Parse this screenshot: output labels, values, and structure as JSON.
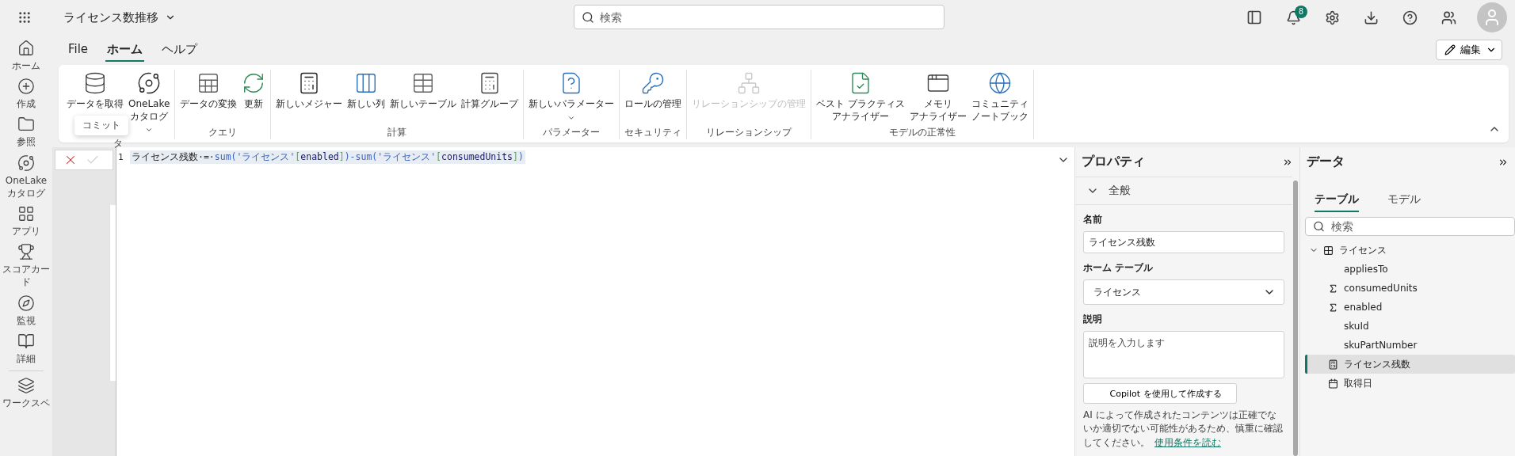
{
  "topbar": {
    "title": "ライセンス数推移",
    "search": {
      "placeholder": "検索"
    },
    "notifications": "8"
  },
  "rail": [
    {
      "label": "ホーム"
    },
    {
      "label": "作成"
    },
    {
      "label": "参照"
    },
    {
      "label": "OneLake カタログ"
    },
    {
      "label": "アプリ"
    },
    {
      "label": "スコアカード"
    },
    {
      "label": "監視"
    },
    {
      "label": "詳細"
    },
    {
      "label": "ワークスペ"
    }
  ],
  "ribbon_tabs": [
    {
      "label": "File",
      "selected": false
    },
    {
      "label": "ホーム",
      "selected": true
    },
    {
      "label": "ヘルプ",
      "selected": false
    }
  ],
  "edit_button": "編集",
  "ribbon_groups": [
    {
      "label": "タ",
      "items": [
        {
          "lines": [
            "データを取得"
          ],
          "disabled": false
        },
        {
          "lines": [
            "OneLake",
            "カタログ"
          ],
          "disabled": false,
          "dropdown": true
        }
      ]
    },
    {
      "label": "クエリ",
      "items": [
        {
          "lines": [
            "データの変換"
          ],
          "disabled": false
        },
        {
          "lines": [
            "更新"
          ],
          "disabled": false
        }
      ]
    },
    {
      "label": "計算",
      "items": [
        {
          "lines": [
            "新しいメジャー"
          ],
          "disabled": false
        },
        {
          "lines": [
            "新しい列"
          ],
          "disabled": false
        },
        {
          "lines": [
            "新しいテーブル"
          ],
          "disabled": false
        },
        {
          "lines": [
            "計算グループ"
          ],
          "disabled": false
        }
      ]
    },
    {
      "label": "パラメーター",
      "items": [
        {
          "lines": [
            "新しいパラメーター"
          ],
          "disabled": false,
          "dropdown": true
        }
      ]
    },
    {
      "label": "セキュリティ",
      "items": [
        {
          "lines": [
            "ロールの管理"
          ],
          "disabled": false
        }
      ]
    },
    {
      "label": "リレーションシップ",
      "items": [
        {
          "lines": [
            "リレーションシップの管理"
          ],
          "disabled": true
        }
      ]
    },
    {
      "label": "モデルの正常性",
      "items": [
        {
          "lines": [
            "ベスト プラクティス",
            "アナライザー"
          ],
          "disabled": false
        },
        {
          "lines": [
            "メモリ",
            "アナライザー"
          ],
          "disabled": false
        },
        {
          "lines": [
            "コミュニティ",
            "ノートブック"
          ],
          "disabled": false
        }
      ]
    }
  ],
  "tooltip": "コミット",
  "editor": {
    "line_number": "1",
    "tokens": [
      {
        "kind": "text",
        "text": "ライセンス残数·=·"
      },
      {
        "kind": "func",
        "text": "sum("
      },
      {
        "kind": "string",
        "text": "'ライセンス'"
      },
      {
        "kind": "bracket",
        "text": "["
      },
      {
        "kind": "column",
        "text": "enabled"
      },
      {
        "kind": "bracket",
        "text": "]"
      },
      {
        "kind": "func",
        "text": ")-sum("
      },
      {
        "kind": "string",
        "text": "'ライセンス'"
      },
      {
        "kind": "bracket",
        "text": "["
      },
      {
        "kind": "column",
        "text": "consumedUnits"
      },
      {
        "kind": "bracket",
        "text": "]"
      },
      {
        "kind": "func",
        "text": ")"
      }
    ]
  },
  "properties": {
    "title": "プロパティ",
    "section": {
      "label": "全般",
      "expanded": true
    },
    "name_label": "名前",
    "name_value": "ライセンス残数",
    "home_table_label": "ホーム テーブル",
    "home_table_value": "ライセンス",
    "description_label": "説明",
    "description_placeholder": "説明を入力します",
    "copilot_button": "Copilot を使用して作成する",
    "note": "AI によって作成されたコンテンツは正確でないか適切でない可能性があるため、慎重に確認してください。",
    "note_link": "使用条件を読む"
  },
  "data": {
    "title": "データ",
    "tabs": [
      {
        "label": "テーブル",
        "selected": true
      },
      {
        "label": "モデル",
        "selected": false
      }
    ],
    "search": {
      "placeholder": "検索"
    },
    "tree": [
      {
        "label": "ライセンス",
        "kind": "table",
        "expanded": true,
        "selected": false,
        "children": [
          {
            "label": "appliesTo",
            "kind": "column",
            "selected": false
          },
          {
            "label": "consumedUnits",
            "kind": "sum",
            "selected": false
          },
          {
            "label": "enabled",
            "kind": "sum",
            "selected": false
          },
          {
            "label": "skuId",
            "kind": "column",
            "selected": false
          },
          {
            "label": "skuPartNumber",
            "kind": "column",
            "selected": false
          },
          {
            "label": "ライセンス残数",
            "kind": "measure",
            "selected": true
          },
          {
            "label": "取得日",
            "kind": "date",
            "selected": false
          }
        ]
      }
    ]
  }
}
